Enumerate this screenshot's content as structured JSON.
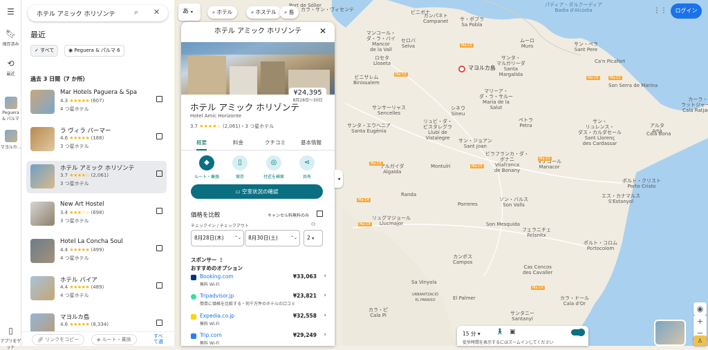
{
  "search": {
    "query": "ホテル アミック ホリゾンテ"
  },
  "rail": {
    "menu": "☰",
    "items": [
      {
        "label": "保存済み"
      },
      {
        "label": "最近"
      },
      {
        "label": "Peguera & パルマ"
      },
      {
        "label": "マヨルカ..."
      },
      {
        "label": "アプリをゲット"
      }
    ]
  },
  "recent": {
    "title": "最近",
    "chips": [
      {
        "label": "すべて"
      },
      {
        "label": "Peguera & パルマ",
        "count": "6"
      }
    ],
    "section": "過去 3 日間（7 か所）",
    "hotels": [
      {
        "name": "Mar Hotels Paguera & Spa",
        "rating": "4.3",
        "stars": "★★★★★",
        "reviews": "(607)",
        "type": "4 つ星ホテル"
      },
      {
        "name": "ラ ヴィラ パーマー",
        "rating": "4.6",
        "stars": "★★★★★",
        "reviews": "(188)",
        "type": "3 つ星ホテル"
      },
      {
        "name": "ホテル アミック ホリゾンテ",
        "rating": "3.7",
        "stars": "★★★★☆",
        "reviews": "(2,061)",
        "type": "3 つ星ホテル"
      },
      {
        "name": "New Art Hostel",
        "rating": "3.4",
        "stars": "★★★☆☆",
        "reviews": "(698)",
        "type": "3 つ星ホテル"
      },
      {
        "name": "Hotel La Concha Soul",
        "rating": "4.4",
        "stars": "★★★★★",
        "reviews": "(499)",
        "type": "4 つ星ホテル"
      },
      {
        "name": "ホテル バイア",
        "rating": "4.4",
        "stars": "★★★★★",
        "reviews": "(489)",
        "type": "4 つ星ホテル"
      },
      {
        "name": "マヨルカ島",
        "rating": "4.6",
        "stars": "★★★★★",
        "reviews": "(8,334)",
        "type": ""
      }
    ],
    "copy_link": "リンクをコピー",
    "directions": "ルート・乗換",
    "view_all": "すべて選"
  },
  "top_chips": {
    "lang": "あ",
    "hotel": "ホテル",
    "hostel": "ホステル",
    "island": "島"
  },
  "detail": {
    "header": "ホテル アミック ホリゾンテ",
    "price": "¥24,395",
    "dates": "8月28日〜30日",
    "name": "ホテル アミック ホリゾンテ",
    "subtitle": "Hotel Amic Horizonte",
    "rating": "3.7",
    "stars": "★★★★☆",
    "rating_rest": "(2,061)・3 つ星ホテル",
    "tabs": [
      "概要",
      "料金",
      "クチコミ",
      "基本情報"
    ],
    "actions": [
      "ルート・乗換",
      "保存",
      "付近を検索",
      "共有"
    ],
    "availability": "空室状況の確認",
    "compare_title": "価格を比較",
    "cancel_label": "キャンセル料無料のみ",
    "checkin_label": "チェックイン / チェックアウト",
    "checkin": "8月28日(木)",
    "checkout": "8月30日(土)",
    "guests": "2",
    "sponsor": "スポンサー",
    "options": "おすすめのオプション",
    "offers": [
      {
        "name": "Booking.com",
        "desc": "無料 Wi-Fi",
        "price": "¥33,063",
        "color": "#003580"
      },
      {
        "name": "Tripadvisor.jp",
        "desc": "簡単に価格を比較する・何千万件のホテルの口コミ",
        "price": "¥23,821",
        "color": "#34e0a1"
      },
      {
        "name": "Expedia.co.jp",
        "desc": "無料 Wi-Fi",
        "price": "¥32,558",
        "color": "#fdd400"
      },
      {
        "name": "Trip.com",
        "desc": "無料 Wi-Fi",
        "price": "¥29,249",
        "color": "#287dfa"
      }
    ]
  },
  "map": {
    "pin_label": "マヨルカ島",
    "labels": [
      {
        "t": "Port de Sóller"
      },
      {
        "t": "カラ・サン・ヴィセンテ"
      },
      {
        "t": "パディア・ダルクーディア\nBadia d'Alcúdia"
      },
      {
        "t": "ビニボナ"
      },
      {
        "t": "カンパネト\nCampanet"
      },
      {
        "t": "サ・ポブラ\nSa Pobla"
      },
      {
        "t": "ムーロ\nMuro"
      },
      {
        "t": "サン・ペラ\nSant Pere"
      },
      {
        "t": "マンコール・\nダ・ラ・バイ\nMancor\nde la Vall"
      },
      {
        "t": "セロバ\nSelva"
      },
      {
        "t": "ロセタ\nLloseta"
      },
      {
        "t": "ビニサレム\nBinissalem"
      },
      {
        "t": "サンタ・\nマルガリーダ\nSanta\nMargalida"
      },
      {
        "t": "マリーア・\nダ・ラ・サルー\nMaria de la\nSalut"
      },
      {
        "t": "サンサーリャス\nSencelles"
      },
      {
        "t": "シネウ\nSineu"
      },
      {
        "t": "リュビ・ダ・\nビスタレグラ\nLlubí de\nVistalegre"
      },
      {
        "t": "サン・ジョアン\nSant Joan"
      },
      {
        "t": "サンタ・エウヘニア\nSanta Eugènia"
      },
      {
        "t": "ペトラ\nPetra"
      },
      {
        "t": "アルタ\nArtà"
      },
      {
        "t": "カーラ・\nラットジャーダ\nCala Ratjada"
      },
      {
        "t": "サン・\nリュレンス・\nダス・カルダセール\nSant Llorenç\ndes Cardassar"
      },
      {
        "t": "ビラフランカ・ダ・\nボナニ\nVilafranca\nde Bonany"
      },
      {
        "t": "マナコール\nManacor"
      },
      {
        "t": "Montuïri"
      },
      {
        "t": "アルガイダ\nAlgaida"
      },
      {
        "t": "Porreres"
      },
      {
        "t": "ソン・バルス\nSon Valls"
      },
      {
        "t": "リュグマジョール\nLlucmajor"
      },
      {
        "t": "Randa"
      },
      {
        "t": "Son Mesquida"
      },
      {
        "t": "フェラニチェ\nFelanitx"
      },
      {
        "t": "カンポス\nCampos"
      },
      {
        "t": "Cas Concos\ndes Cavaller"
      },
      {
        "t": "Sa Vinyola"
      },
      {
        "t": "El Palmer"
      },
      {
        "t": "URBANITZACIÓ\nEL PARAISO"
      },
      {
        "t": "ポルト・クリスト\nPorto Cristo"
      },
      {
        "t": "エス・カナマルス\nS'Estanyol"
      },
      {
        "t": "ポルト・コロム\nPortocolom"
      },
      {
        "t": "サンタニー\nSantanyí"
      },
      {
        "t": "カラ・ドール\nCala d'Or"
      },
      {
        "t": "カラ・ピ\nCala Pi"
      },
      {
        "t": "Ca'n Picafort"
      },
      {
        "t": "Cala Bona"
      },
      {
        "t": "Son Serra de Marina"
      }
    ],
    "roads": [
      "Ma-13",
      "Ma-15",
      "Ma-12",
      "Ma-19",
      "Ma-14",
      "Ma-19",
      "Ma-15",
      "Ma-15",
      "Ma-13",
      "Ma-14"
    ]
  },
  "controls": {
    "login": "ログイン",
    "travel_time": "15 分",
    "travel_hint": "徒歩時間を表示するにはズームインしてください"
  }
}
